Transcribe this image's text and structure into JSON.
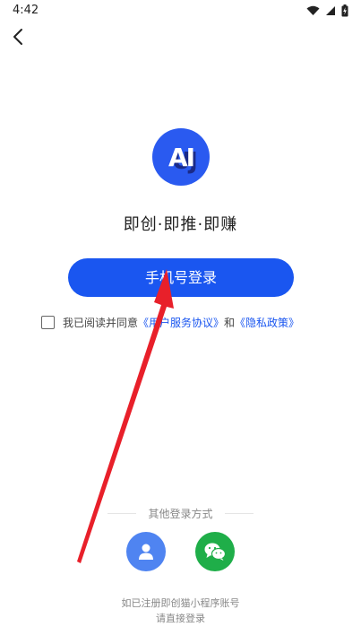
{
  "status_bar": {
    "time": "4:42"
  },
  "logo": {
    "text": "AI",
    "shadow_text": "UJ"
  },
  "slogan": "即创·即推·即赚",
  "login_button": {
    "label": "手机号登录"
  },
  "agreement": {
    "prefix": "我已阅读并同意",
    "service_link": "《用户服务协议》",
    "joiner": "和",
    "privacy_link": "《隐私政策》"
  },
  "other_login": {
    "title": "其他登录方式"
  },
  "notes": {
    "line1": "如已注册即创猫小程序账号",
    "line2": "请直接登录"
  },
  "colors": {
    "primary": "#1a56f0",
    "logo_bg": "#2a5af0",
    "account_icon_bg": "#4f84f1",
    "wechat_icon_bg": "#1fae49",
    "annotation_arrow": "#e8202a"
  },
  "icons": {
    "back": "chevron-left-icon",
    "account": "person-icon",
    "wechat": "wechat-icon",
    "wifi": "wifi-icon",
    "signal": "signal-icon",
    "battery": "battery-icon"
  }
}
